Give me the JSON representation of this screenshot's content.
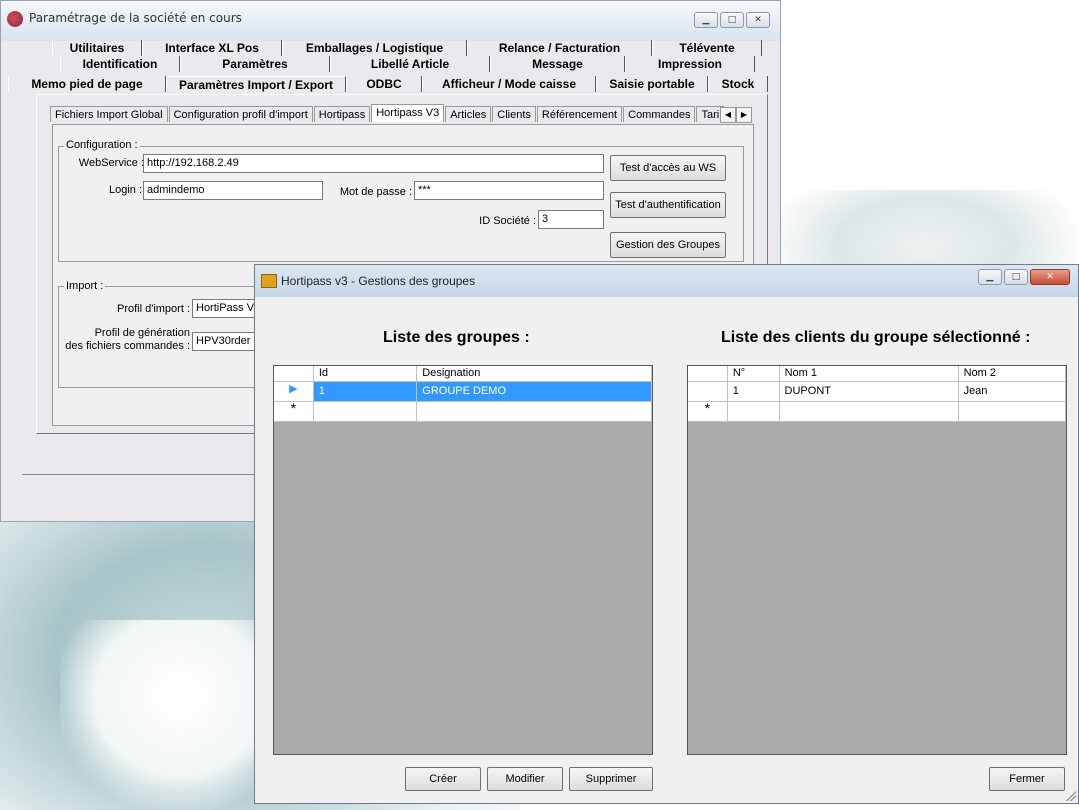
{
  "back_window": {
    "title": "Paramétrage de la société en cours",
    "tabs_row1": [
      "Utilitaires",
      "Interface XL Pos",
      "Emballages / Logistique",
      "Relance / Facturation",
      "Télévente"
    ],
    "tabs_row2": [
      "Identification",
      "Paramètres",
      "Libellé Article",
      "Message",
      "Impression"
    ],
    "tabs_row3": [
      "Memo pied de page",
      "Paramètres Import / Export",
      "ODBC",
      "Afficheur / Mode caisse",
      "Saisie portable",
      "Stock"
    ],
    "subtabs": [
      "Fichiers Import Global",
      "Configuration profil d'import",
      "Hortipass",
      "Hortipass V3",
      "Articles",
      "Clients",
      "Référencement",
      "Commandes",
      "Tari"
    ],
    "config": {
      "legend": "Configuration :",
      "webservice_label": "WebService :",
      "webservice_value": "http://192.168.2.49",
      "login_label": "Login :",
      "login_value": "admindemo",
      "password_label": "Mot de passe :",
      "password_value": "***",
      "societe_label": "ID Société :",
      "societe_value": "3",
      "btn_test_ws": "Test d'accès au WS",
      "btn_test_auth": "Test d'authentification",
      "btn_groups": "Gestion des Groupes"
    },
    "import": {
      "legend": "Import :",
      "profil_label": "Profil d'import :",
      "profil_value": "HortiPass V",
      "gen_label_1": "Profil de génération",
      "gen_label_2": "des fichiers commandes :",
      "gen_value": "HPV30rder"
    }
  },
  "dialog": {
    "title": "Hortipass v3 - Gestions des groupes",
    "groups_heading": "Liste des groupes :",
    "clients_heading": "Liste des clients du groupe sélectionné :",
    "groups_columns": [
      "Id",
      "Designation"
    ],
    "groups_rows": [
      {
        "id": "1",
        "designation": "GROUPE DEMO"
      }
    ],
    "clients_columns": [
      "N°",
      "Nom 1",
      "Nom 2"
    ],
    "clients_rows": [
      {
        "n": "1",
        "nom1": "DUPONT",
        "nom2": "Jean"
      }
    ],
    "new_row_marker": "*",
    "btn_create": "Créer",
    "btn_modify": "Modifier",
    "btn_delete": "Supprimer",
    "btn_close": "Fermer"
  }
}
